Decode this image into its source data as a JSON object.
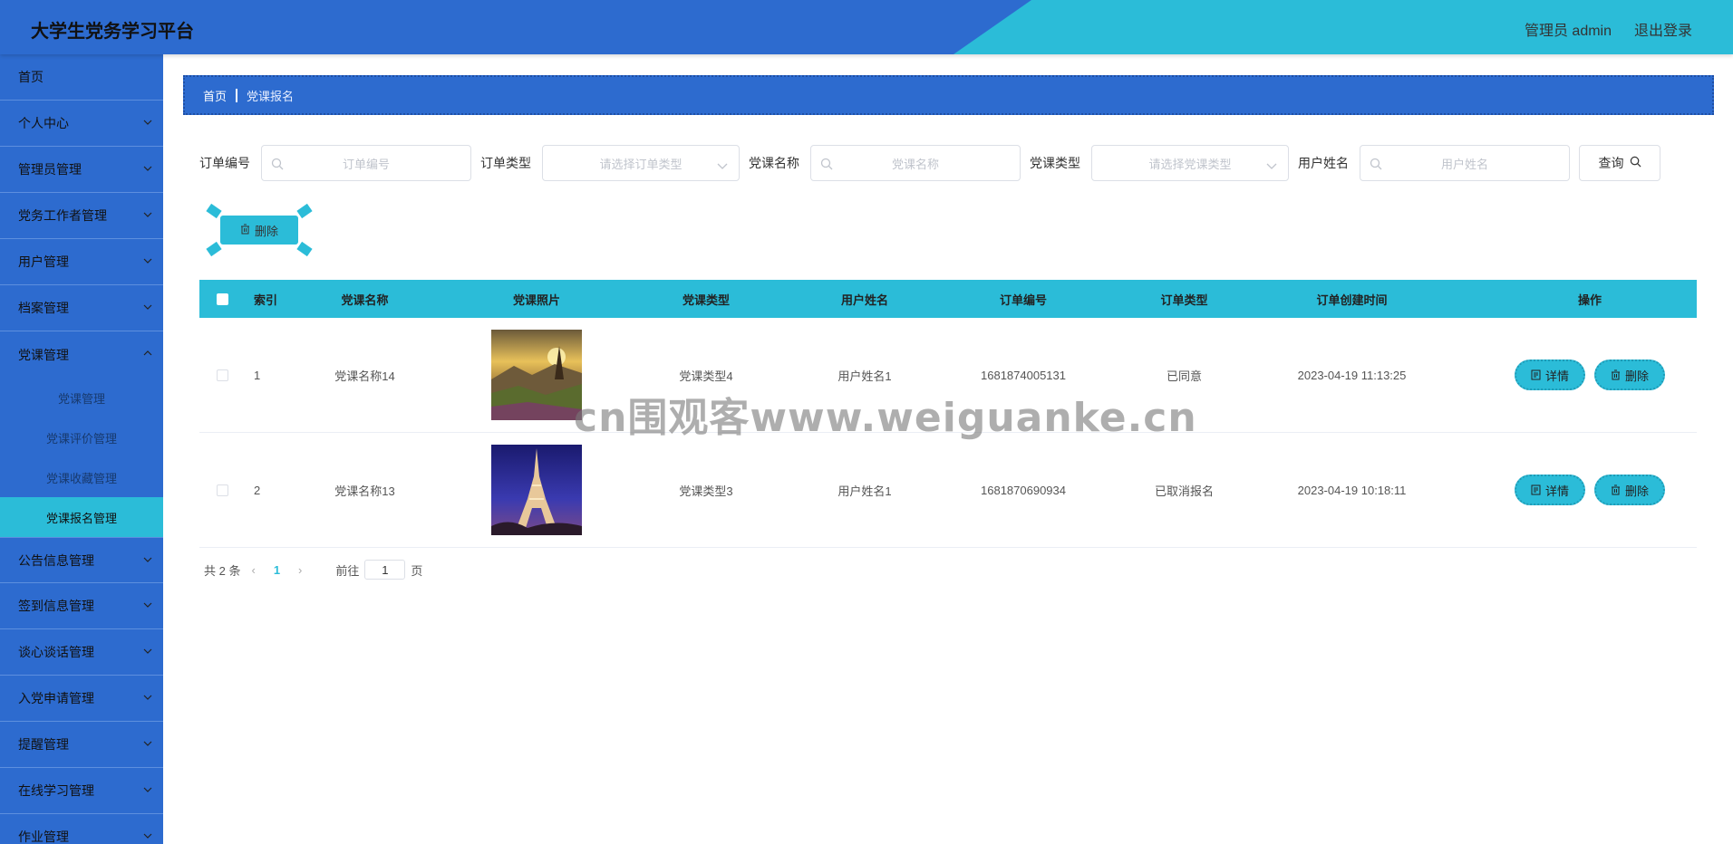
{
  "header": {
    "title": "大学生党务学习平台",
    "admin": "管理员 admin",
    "logout": "退出登录"
  },
  "sidebar": {
    "items": [
      {
        "label": "首页"
      },
      {
        "label": "个人中心"
      },
      {
        "label": "管理员管理"
      },
      {
        "label": "党务工作者管理"
      },
      {
        "label": "用户管理"
      },
      {
        "label": "档案管理"
      },
      {
        "label": "党课管理"
      },
      {
        "label": "公告信息管理"
      },
      {
        "label": "签到信息管理"
      },
      {
        "label": "谈心谈话管理"
      },
      {
        "label": "入党申请管理"
      },
      {
        "label": "提醒管理"
      },
      {
        "label": "在线学习管理"
      },
      {
        "label": "作业管理"
      }
    ],
    "submenu": [
      {
        "label": "党课管理"
      },
      {
        "label": "党课评价管理"
      },
      {
        "label": "党课收藏管理"
      },
      {
        "label": "党课报名管理"
      }
    ]
  },
  "breadcrumb": {
    "home": "首页",
    "current": "党课报名"
  },
  "search": {
    "order_no_label": "订单编号",
    "order_no_placeholder": "订单编号",
    "order_type_label": "订单类型",
    "order_type_placeholder": "请选择订单类型",
    "course_name_label": "党课名称",
    "course_name_placeholder": "党课名称",
    "course_type_label": "党课类型",
    "course_type_placeholder": "请选择党课类型",
    "user_name_label": "用户姓名",
    "user_name_placeholder": "用户姓名",
    "query_label": "查询"
  },
  "actions": {
    "delete_label": "删除"
  },
  "table": {
    "headers": {
      "index": "索引",
      "name": "党课名称",
      "photo": "党课照片",
      "type": "党课类型",
      "user": "用户姓名",
      "order": "订单编号",
      "otype": "订单类型",
      "time": "订单创建时间",
      "ops": "操作"
    },
    "rows": [
      {
        "index": "1",
        "name": "党课名称14",
        "photo": "landscape-sunset-photo",
        "type": "党课类型4",
        "user": "用户姓名1",
        "order": "1681874005131",
        "otype": "已同意",
        "time": "2023-04-19 11:13:25",
        "detail": "详情",
        "delete": "删除"
      },
      {
        "index": "2",
        "name": "党课名称13",
        "photo": "eiffel-tower-night-photo",
        "type": "党课类型3",
        "user": "用户姓名1",
        "order": "1681870690934",
        "otype": "已取消报名",
        "time": "2023-04-19 10:18:11",
        "detail": "详情",
        "delete": "删除"
      }
    ]
  },
  "pager": {
    "total": "共 2 条",
    "page": "1",
    "goto": "前往",
    "goto_value": "1",
    "page_suffix": "页"
  },
  "watermark": "cn围观客www.weiguanke.cn",
  "colors": {
    "primary": "#2d6bcf",
    "accent": "#2bbcd8"
  }
}
